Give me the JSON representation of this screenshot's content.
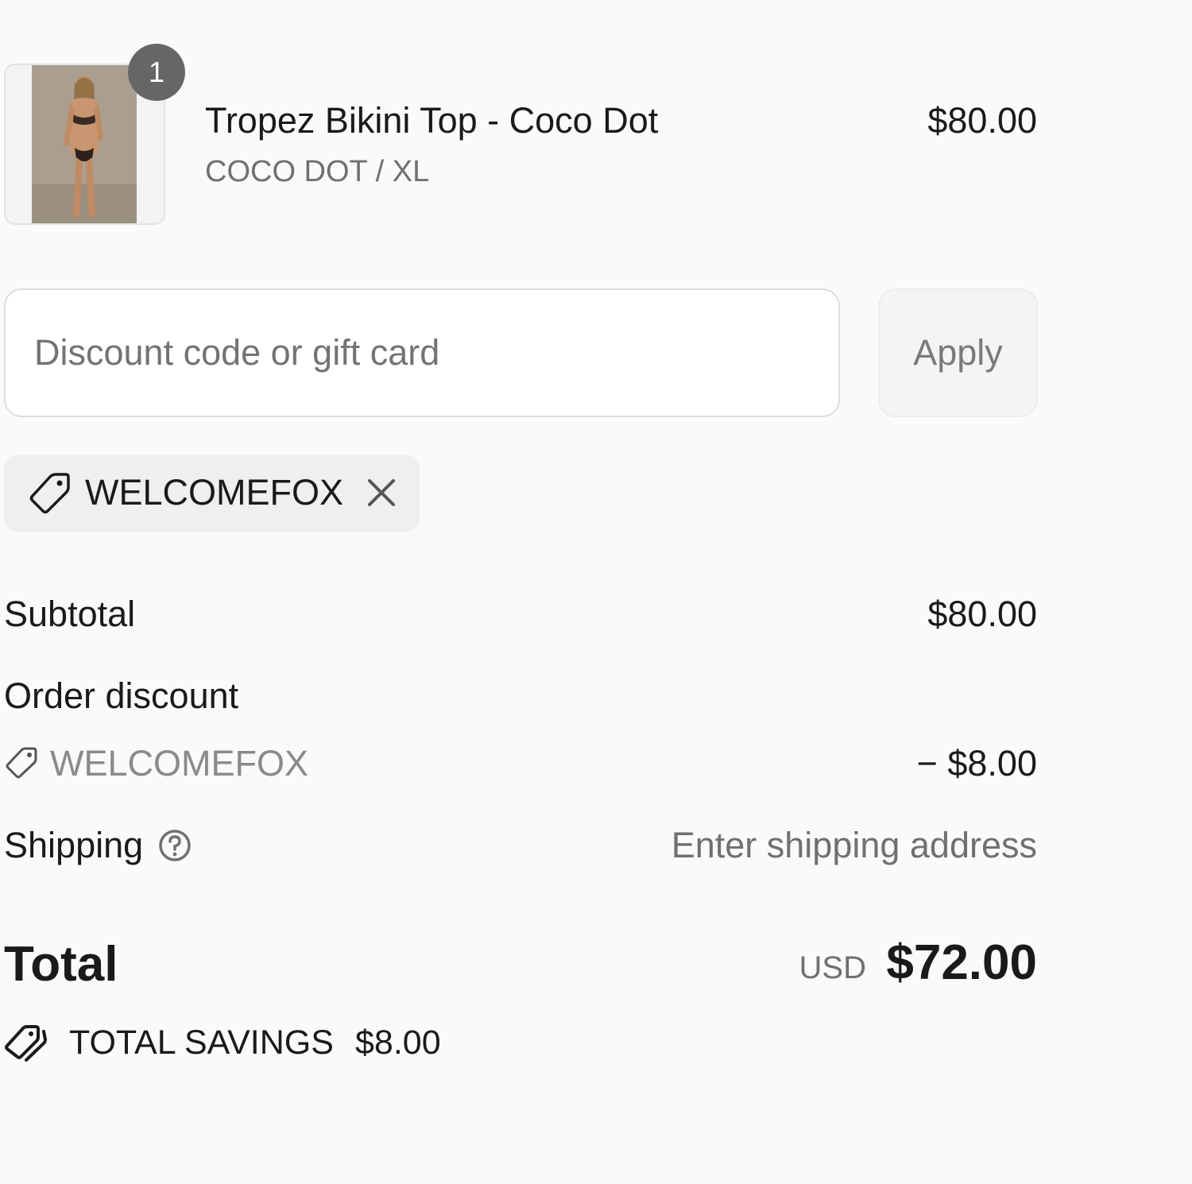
{
  "line_item": {
    "quantity": "1",
    "title": "Tropez Bikini Top - Coco Dot",
    "variant": "COCO DOT / XL",
    "price": "$80.00",
    "image_icon": "product-photo"
  },
  "discount": {
    "placeholder": "Discount code or gift card",
    "value": "",
    "apply_label": "Apply",
    "applied_code": "WELCOMEFOX"
  },
  "summary": {
    "subtotal_label": "Subtotal",
    "subtotal_value": "$80.00",
    "order_discount_label": "Order discount",
    "discount_code": "WELCOMEFOX",
    "discount_value": "− $8.00",
    "shipping_label": "Shipping",
    "shipping_value": "Enter shipping address",
    "total_label": "Total",
    "total_currency": "USD",
    "total_value": "$72.00",
    "savings_label": "TOTAL SAVINGS",
    "savings_value": "$8.00"
  },
  "colors": {
    "background": "#fafafa",
    "text": "#1a1a1a",
    "muted": "#707070",
    "badge": "#666666"
  }
}
